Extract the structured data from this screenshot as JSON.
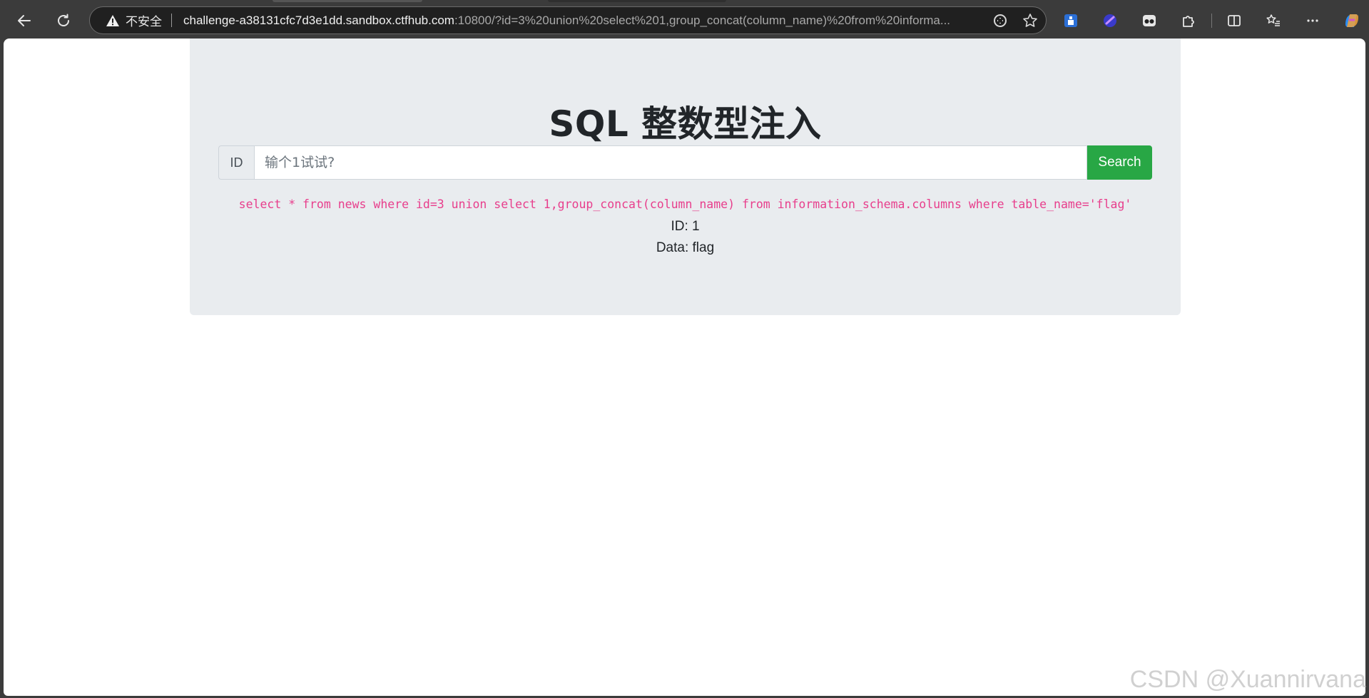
{
  "browser": {
    "back_icon": "back-arrow-icon",
    "reload_icon": "reload-icon",
    "security_label": "不安全",
    "url_host": "challenge-a38131cfc7d3e1dd.sandbox.ctfhub.com",
    "url_rest": ":10800/?id=3%20union%20select%201,group_concat(column_name)%20from%20informa...",
    "address_icons": [
      "read-aloud-icon",
      "favorite-star-icon"
    ],
    "extensions": [
      "extension-icon-blue",
      "extension-icon-purple",
      "extension-icon-glasses",
      "extensions-puzzle-icon",
      "split-screen-icon",
      "favorites-list-icon",
      "more-menu-icon",
      "copilot-icon"
    ]
  },
  "page": {
    "title": "SQL 整数型注入",
    "input_prefix": "ID",
    "input_placeholder": "输个1试试?",
    "search_label": "Search",
    "query": "select * from news where id=3 union select 1,group_concat(column_name) from information_schema.columns where table_name='flag'",
    "result_id": "ID: 1",
    "result_data": "Data: flag"
  },
  "watermark": "CSDN @Xuannirvana",
  "colors": {
    "jumbotron_bg": "#e9ecef",
    "search_button": "#28a745",
    "query_text": "#e83e8c",
    "browser_chrome": "#3b3b3b"
  }
}
